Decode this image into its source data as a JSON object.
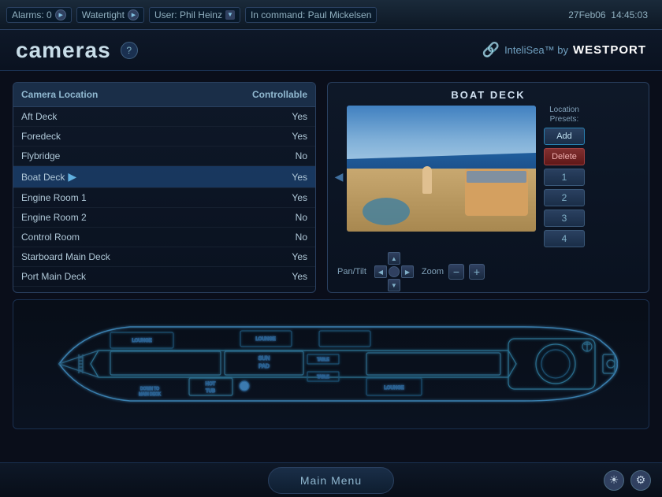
{
  "topbar": {
    "alarms_label": "Alarms: 0",
    "watertight_label": "Watertight",
    "user_label": "User: Phil Heinz",
    "incommand_label": "In command: Paul Mickelsen",
    "date": "27Feb06",
    "time": "14:45:03"
  },
  "header": {
    "title": "cameras",
    "help": "?",
    "logo_text": "InteliSea™ by ",
    "logo_brand": "WESTPORT"
  },
  "camera_table": {
    "col_location": "Camera Location",
    "col_controllable": "Controllable",
    "rows": [
      {
        "location": "Aft Deck",
        "controllable": "Yes",
        "selected": false
      },
      {
        "location": "Foredeck",
        "controllable": "Yes",
        "selected": false
      },
      {
        "location": "Flybridge",
        "controllable": "No",
        "selected": false
      },
      {
        "location": "Boat Deck",
        "controllable": "Yes",
        "selected": true
      },
      {
        "location": "Engine Room 1",
        "controllable": "Yes",
        "selected": false
      },
      {
        "location": "Engine Room 2",
        "controllable": "No",
        "selected": false
      },
      {
        "location": "Control Room",
        "controllable": "No",
        "selected": false
      },
      {
        "location": "Starboard Main Deck",
        "controllable": "Yes",
        "selected": false
      },
      {
        "location": "Port Main Deck",
        "controllable": "Yes",
        "selected": false
      }
    ]
  },
  "camera_viewer": {
    "title": "BOAT DECK",
    "presets_label": "Location\nPresets:",
    "add_btn": "Add",
    "delete_btn": "Delete",
    "preset_1": "1",
    "preset_2": "2",
    "preset_3": "3",
    "preset_4": "4",
    "pantilt_label": "Pan/Tilt",
    "zoom_label": "Zoom"
  },
  "bottom": {
    "main_menu": "Main Menu"
  }
}
